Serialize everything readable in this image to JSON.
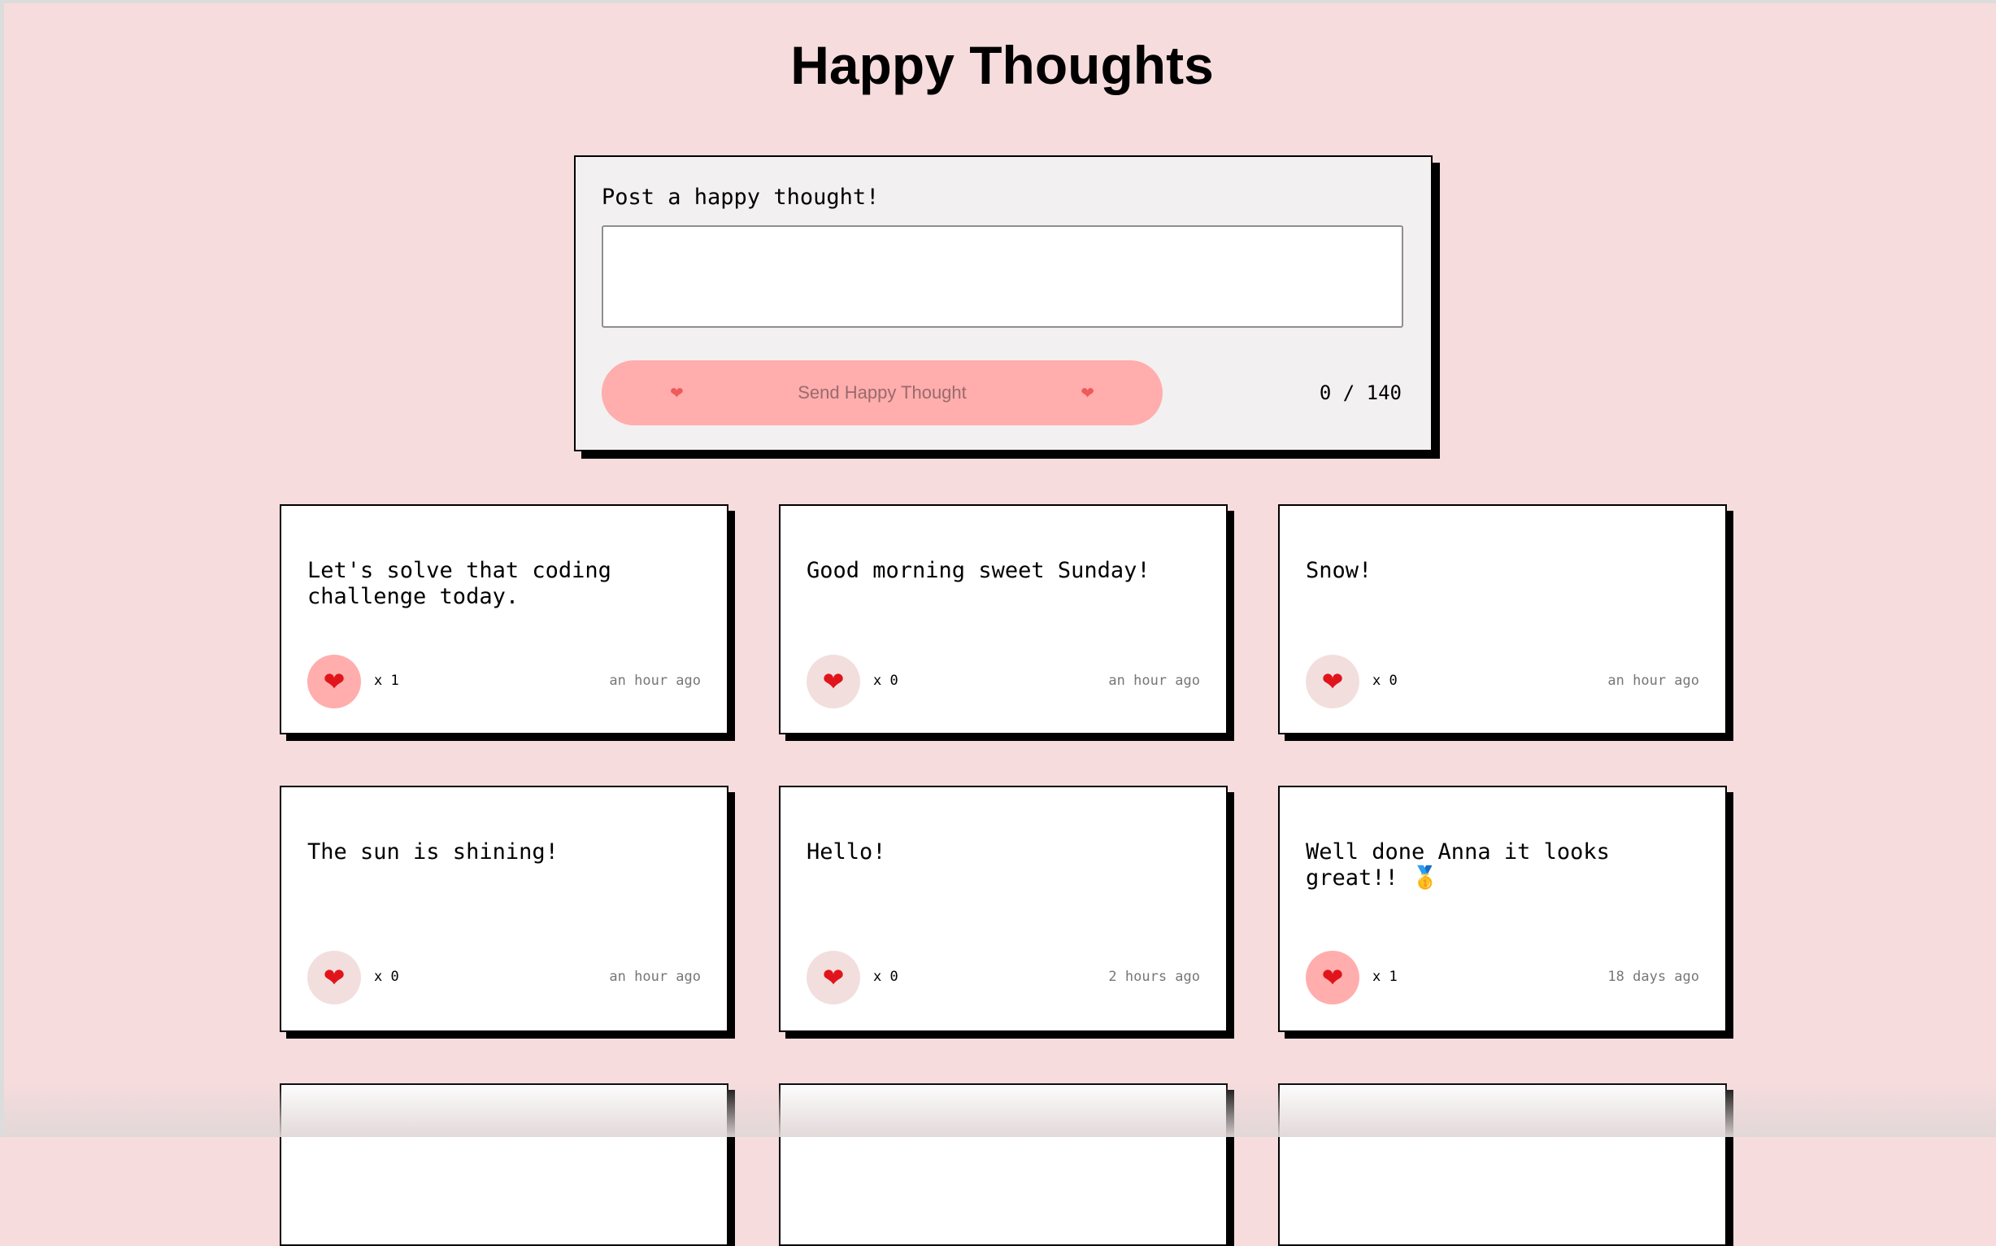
{
  "header": {
    "title": "Happy Thoughts"
  },
  "composer": {
    "label": "Post a happy thought!",
    "input_value": "",
    "input_placeholder": "",
    "send_label": "Send Happy Thought",
    "char_count": "0 / 140"
  },
  "colors": {
    "background": "#f7dcdd",
    "button": "#ffadad",
    "like_inactive": "#f3dede",
    "like_active": "#ffadad",
    "heart": "#e0151b"
  },
  "icons": {
    "heart": "heart-icon",
    "medal": "medal-icon"
  },
  "thoughts": [
    {
      "message": "Let's solve that coding challenge today.",
      "likes": "x 1",
      "time": "an hour ago",
      "liked": true
    },
    {
      "message": "Good morning sweet Sunday!",
      "likes": "x 0",
      "time": "an hour ago",
      "liked": false
    },
    {
      "message": "Snow!",
      "likes": "x 0",
      "time": "an hour ago",
      "liked": false
    },
    {
      "message": "The sun is shining!",
      "likes": "x 0",
      "time": "an hour ago",
      "liked": false
    },
    {
      "message": "Hello!",
      "likes": "x 0",
      "time": "2 hours ago",
      "liked": false
    },
    {
      "message": "Well done Anna it looks great!! 🥇",
      "likes": "x 1",
      "time": "18 days ago",
      "liked": true
    }
  ]
}
